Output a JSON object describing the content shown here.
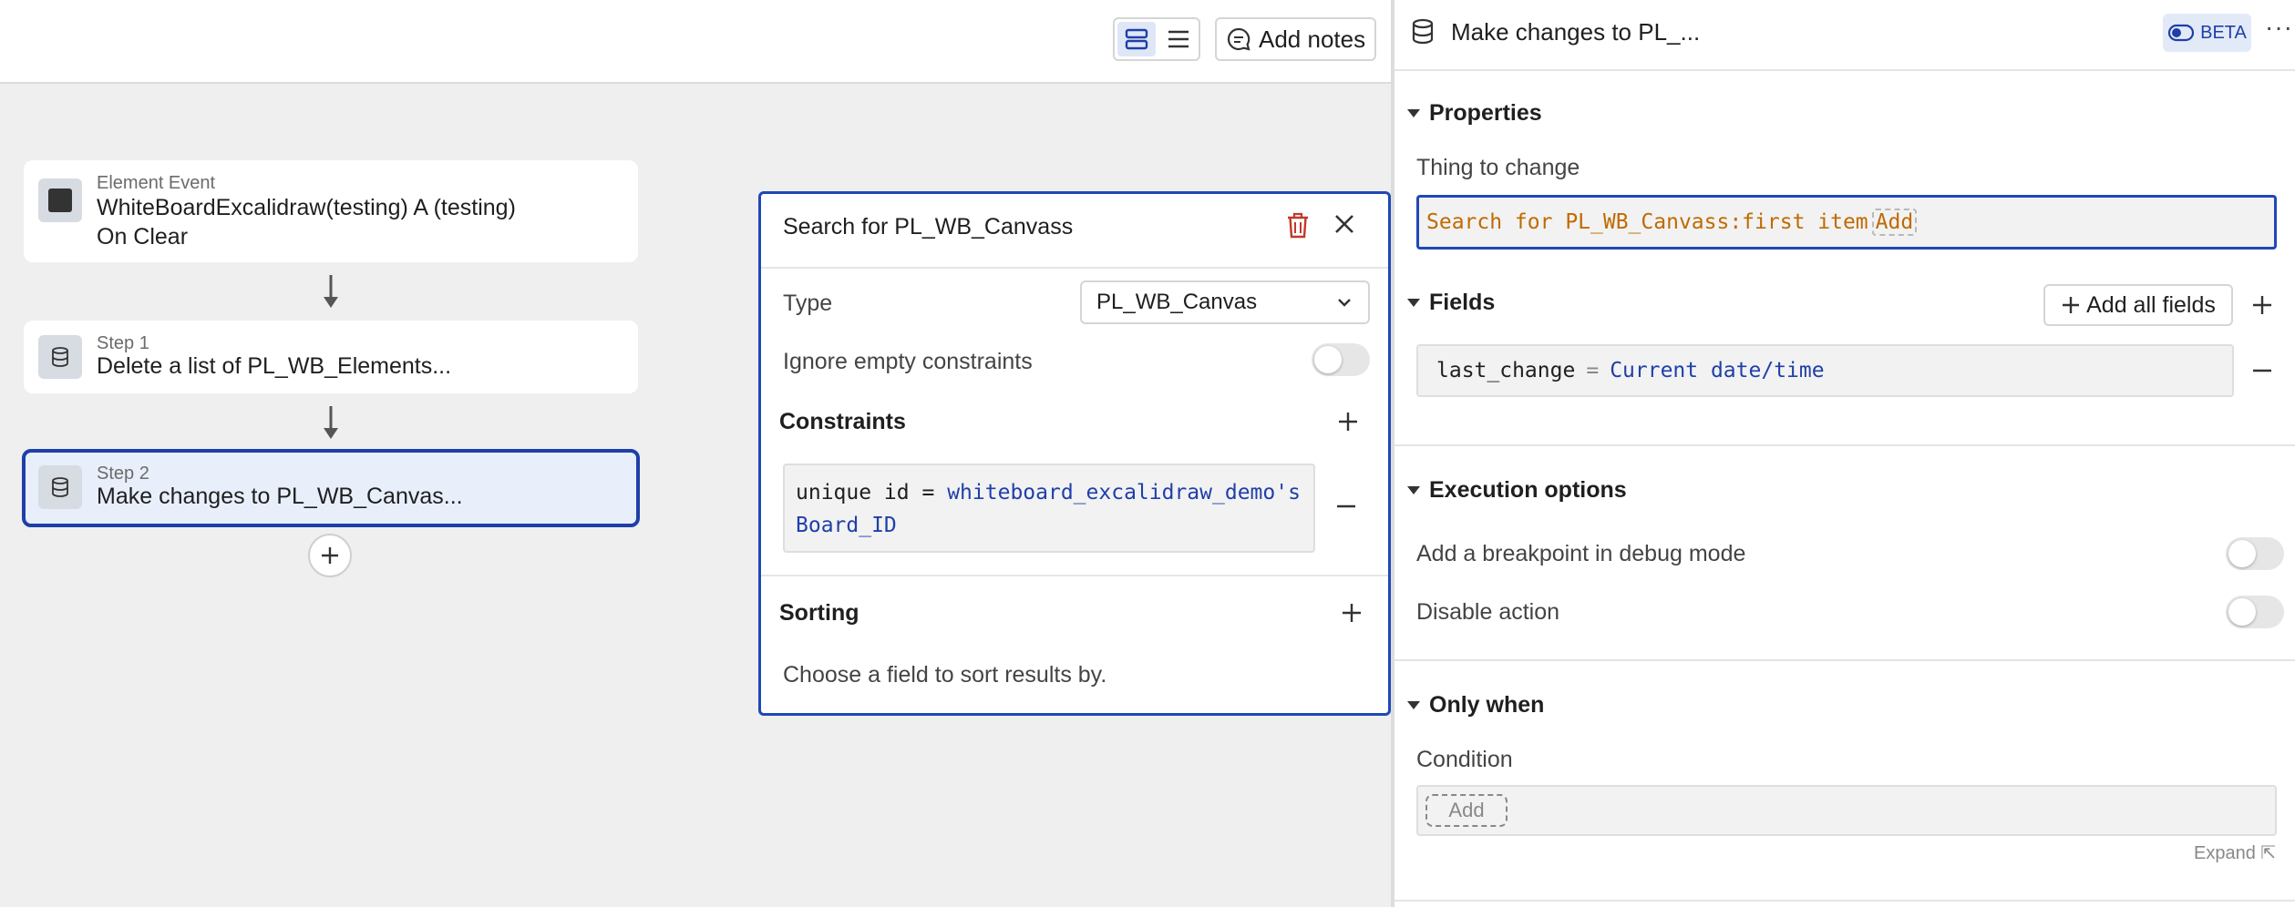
{
  "topbar": {
    "notes_label": "Add notes"
  },
  "workflow": {
    "event_card": {
      "sub": "Element Event",
      "line1": "WhiteBoardExcalidraw(testing) A (testing)",
      "line2": "On Clear"
    },
    "step1": {
      "sub": "Step 1",
      "label": "Delete a list of PL_WB_Elements..."
    },
    "step2": {
      "sub": "Step 2",
      "label": "Make changes to PL_WB_Canvas..."
    }
  },
  "search": {
    "title": "Search for PL_WB_Canvass",
    "type_label": "Type",
    "type_value": "PL_WB_Canvas",
    "ignore_label": "Ignore empty constraints",
    "constraints_label": "Constraints",
    "constraint": {
      "field": "unique id",
      "op": "=",
      "value_line1": "whiteboard_excalidraw_demo's",
      "value_line2": "Board_ID"
    },
    "sorting_label": "Sorting",
    "sorting_hint": "Choose a field to sort results by."
  },
  "panel": {
    "title": "Make changes to PL_...",
    "beta_label": "BETA",
    "more_label": "···",
    "properties_label": "Properties",
    "thing_label": "Thing to change",
    "thing_value": "Search for PL_WB_Canvass:first item",
    "thing_add": "Add",
    "fields_label": "Fields",
    "add_all_label": "Add all fields",
    "field_row": {
      "name": "last_change",
      "op": "=",
      "value": "Current date/time"
    },
    "execution_label": "Execution options",
    "breakpoint_label": "Add a breakpoint in debug mode",
    "disable_label": "Disable action",
    "only_when_label": "Only when",
    "condition_label": "Condition",
    "condition_add": "Add",
    "expand_label": "Expand ⇱"
  },
  "colors": {
    "accent": "#1f48b8",
    "selected_bg": "#e8effb",
    "expr_orange": "#c06a00",
    "expr_blue": "#1f3fa8",
    "danger": "#c0392b"
  }
}
